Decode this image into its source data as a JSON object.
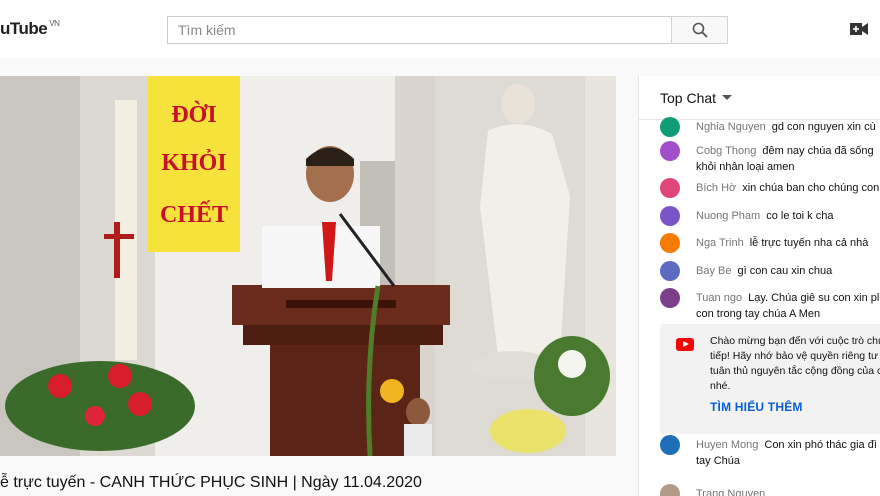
{
  "header": {
    "logo_text": "uTube",
    "logo_region": "VN",
    "search_placeholder": "Tìm kiếm"
  },
  "video": {
    "title": "ễ trực tuyến - CANH THỨC PHỤC SINH | Ngày 11.04.2020",
    "banner_lines": [
      "ĐỜI",
      "KHỎI",
      "CHẾT"
    ]
  },
  "chat": {
    "mode_label": "Top Chat",
    "messages": [
      {
        "author": "Nghia Nguyen",
        "text": "gd con nguyen xin cù",
        "color": "#0f9d78"
      },
      {
        "author": "Cobg Thong",
        "text": "đêm nay chúa đã sống khỏi nhân loại amen",
        "color": "#a24fc9"
      },
      {
        "author": "Bích Hờ",
        "text": "xin chúa ban cho chúng con",
        "color": "#e0457b"
      },
      {
        "author": "Nuong Pham",
        "text": "co le toi k cha",
        "color": "#7a55c9"
      },
      {
        "author": "Nga Trinh",
        "text": "lễ trực tuyến nha cả nhà",
        "color": "#f57c00"
      },
      {
        "author": "Bay Be",
        "text": "gì con cau xin chua",
        "color": "#5c6bc0"
      },
      {
        "author": "Tuan ngo",
        "text": "Lạy. Chúa giê su con xin pl con trong tay chúa A Men",
        "color": "#7b3f8c"
      },
      {
        "author": "Huyen Mong",
        "text": "Con xin phó thác gia đì tay Chúa",
        "color": "#1e6fb8"
      },
      {
        "author": "Trang Nguyen",
        "text": "",
        "color": "#b39b8a"
      }
    ],
    "notice": {
      "text": "Chào mừng bạn đến với cuộc trò chu tiếp! Hãy nhớ bảo vệ quyền riêng tư c tuân thủ nguyên tắc cộng đồng của c nhé.",
      "link": "TÌM HIỂU THÊM"
    }
  }
}
